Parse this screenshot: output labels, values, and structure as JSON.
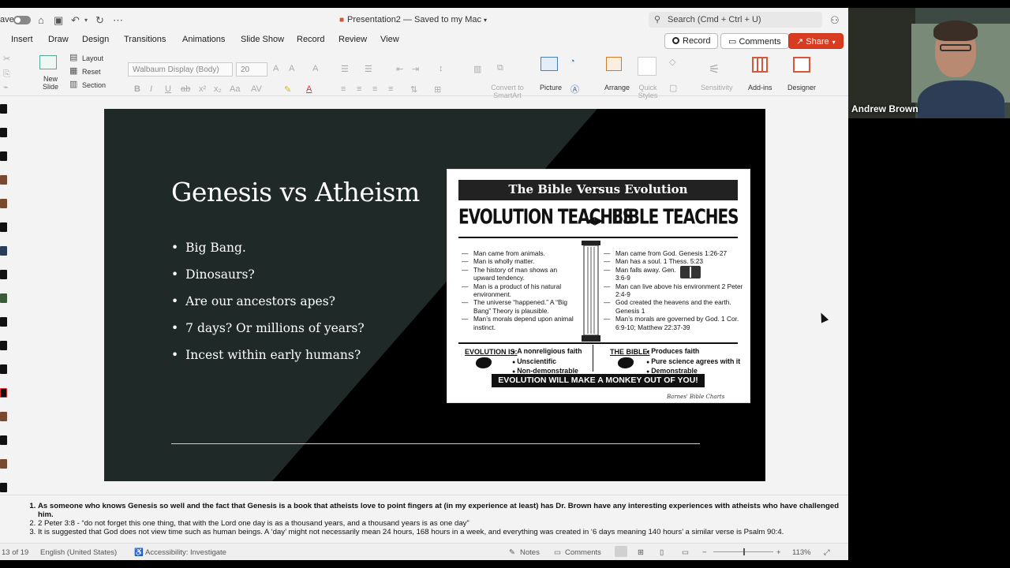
{
  "titlebar": {
    "autosave_label": "ave",
    "document_title": "Presentation2 — Saved to my Mac",
    "search_placeholder": "Search (Cmd + Ctrl + U)"
  },
  "menu": {
    "tabs": [
      "Insert",
      "Draw",
      "Design",
      "Transitions",
      "Animations",
      "Slide Show",
      "Record",
      "Review",
      "View"
    ],
    "record_label": "Record",
    "comments_label": "Comments",
    "share_label": "Share"
  },
  "ribbon": {
    "new_slide": "New Slide",
    "layout": "Layout",
    "reset": "Reset",
    "section": "Section",
    "font_name": "Walbaum Display (Body)",
    "font_size": "20",
    "convert_smartart": "Convert to SmartArt",
    "picture": "Picture",
    "arrange": "Arrange",
    "quick_styles": "Quick Styles",
    "sensitivity": "Sensitivity",
    "add_ins": "Add-ins",
    "designer": "Designer"
  },
  "slide": {
    "title": "Genesis vs Atheism",
    "bullets": [
      "Big Bang.",
      "Dinosaurs?",
      "Are our ancestors apes?",
      "7 days? Or millions of years?",
      "Incest within early humans?"
    ],
    "image": {
      "header": "The Bible Versus Evolution",
      "left_heading": "EVOLUTION TEACHES",
      "right_heading": "BIBLE TEACHES",
      "left_points": [
        "Man came from animals.",
        "Man is wholly matter.",
        "The history of man shows an upward tendency.",
        "Man is a product of his natural environment.",
        "The universe “happened.” A “Big Bang” Theory is plausible.",
        "Man’s morals depend upon animal instinct."
      ],
      "right_points": [
        "Man came from God. Genesis 1:26-27",
        "Man has a soul. 1 Thess. 5:23",
        "Man falls away. Gen. 3:6-9",
        "Man can live above his environment 2 Peter 2:4-9",
        "God created the heavens and the earth. Genesis 1",
        "Man’s morals are governed by God. 1 Cor. 6:9-10; Matthew 22:37-39"
      ],
      "evolution_is_label": "EVOLUTION IS:",
      "evolution_is": [
        "A nonreligious faith",
        "Unscientific",
        "Non-demonstrable"
      ],
      "bible_label": "THE BIBLE:",
      "bible_is": [
        "Produces faith",
        "Pure science agrees with it",
        "Demonstrable"
      ],
      "banner": "EVOLUTION WILL MAKE A MONKEY OUT OF YOU!",
      "credit": "Barnes' Bible Charts"
    }
  },
  "notes": [
    "As someone who knows Genesis so well and the fact that Genesis is a book that atheists love to point fingers at (in my experience at least) has Dr. Brown have any interesting experiences with atheists who have challenged him.",
    "2 Peter 3:8 - “do not forget this one thing, that with the Lord one day is as a thousand years, and a thousand years is as one day”",
    "It is suggested that God does not view time such as human beings. A ‘day’ might not necessarily mean 24 hours, 168 hours in a week, and everything was created in ‘6 days meaning 140 hours’ a similar verse is Psalm 90:4."
  ],
  "status": {
    "slide_counter": "13 of 19",
    "language": "English (United States)",
    "accessibility": "Accessibility: Investigate",
    "notes": "Notes",
    "comments": "Comments",
    "zoom": "113%"
  },
  "video": {
    "participant_name": "Andrew Brown"
  },
  "colors": {
    "share_button": "#d83b1f",
    "slide_dark_panel": "#1f2a28",
    "slide_background": "#000000"
  }
}
